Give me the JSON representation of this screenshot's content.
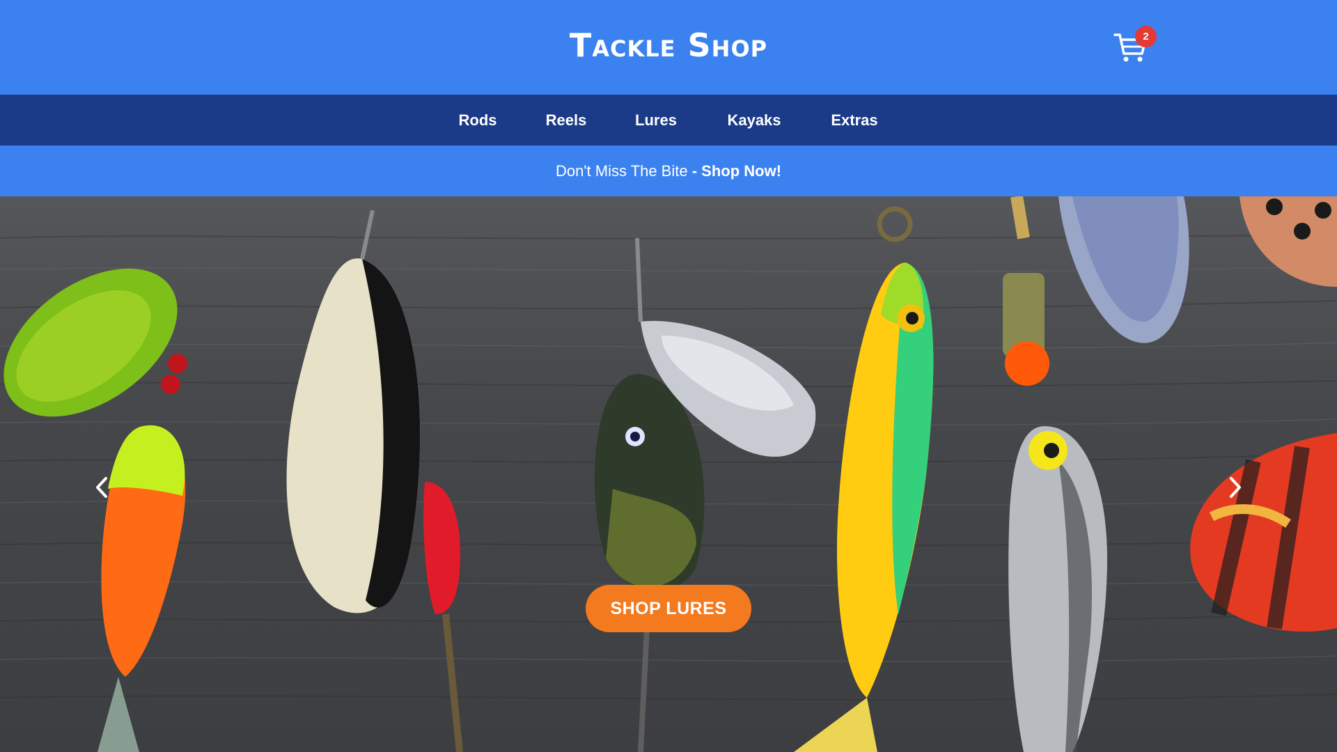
{
  "header": {
    "logo_text": "Tackle Shop",
    "cart_icon": "shopping-cart-icon",
    "cart_count": "2"
  },
  "nav": {
    "items": [
      {
        "label": "Rods"
      },
      {
        "label": "Reels"
      },
      {
        "label": "Lures"
      },
      {
        "label": "Kayaks"
      },
      {
        "label": "Extras"
      }
    ]
  },
  "promo": {
    "text": "Don't Miss The Bite",
    "link_text": "- Shop Now!"
  },
  "hero": {
    "image_desc": "fishing-lures-on-wood",
    "prev_icon": "chevron-left-icon",
    "next_icon": "chevron-right-icon",
    "cta_label": "SHOP LURES"
  },
  "colors": {
    "header_bg": "#3b82f0",
    "nav_bg": "#1b3a87",
    "badge_bg": "#e53935",
    "cta_bg": "#f47a1f"
  }
}
